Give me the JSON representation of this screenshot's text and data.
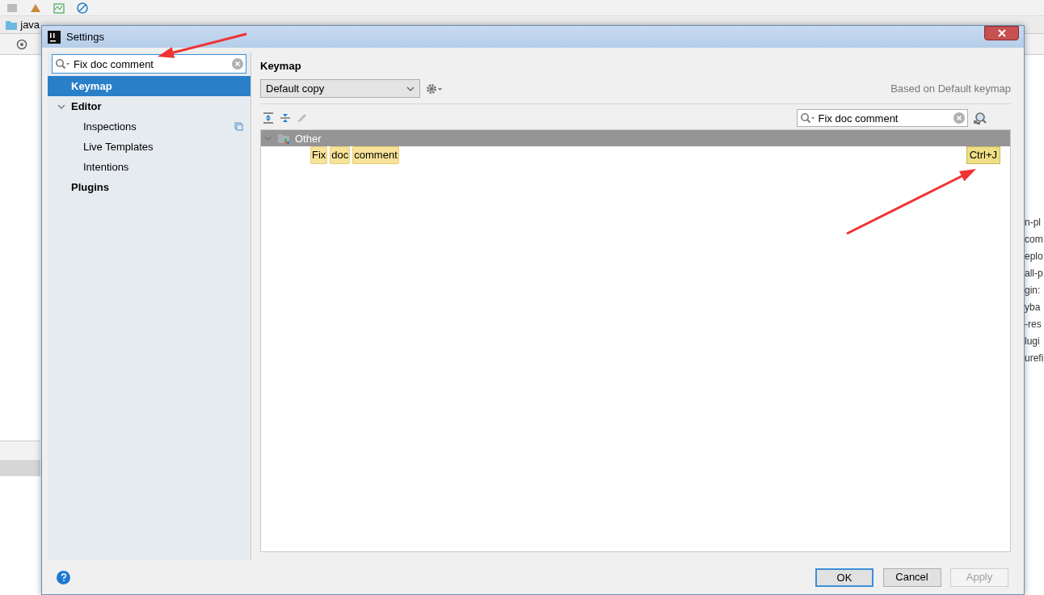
{
  "ide": {
    "breadcrumb": [
      "java"
    ],
    "side_text": [
      "n-pl",
      "com",
      "eplo",
      "all-p",
      "gin:",
      "yba",
      "-res",
      "lugi",
      "urefi"
    ]
  },
  "dialog": {
    "title": "Settings",
    "search": {
      "value": "Fix doc comment"
    },
    "nav": [
      {
        "label": "Keymap",
        "selected": true
      },
      {
        "label": "Editor",
        "selected": false,
        "expanded": true,
        "children": [
          {
            "label": "Inspections",
            "selected": false,
            "project_icon": true
          },
          {
            "label": "Live Templates",
            "selected": false,
            "project_icon": false
          },
          {
            "label": "Intentions",
            "selected": false,
            "project_icon": false
          }
        ]
      },
      {
        "label": "Plugins",
        "selected": false
      }
    ],
    "heading": "Keymap",
    "keymap_select": "Default copy",
    "based_on": "Based on Default keymap",
    "filter": {
      "value": "Fix doc comment"
    },
    "tree": [
      {
        "label": "Other",
        "expanded": true,
        "children": [
          {
            "words": [
              "Fix",
              "doc",
              "comment"
            ],
            "shortcut": "Ctrl+J"
          }
        ]
      }
    ],
    "buttons": [
      {
        "label": "OK",
        "kind": "default"
      },
      {
        "label": "Cancel",
        "kind": "normal"
      },
      {
        "label": "Apply",
        "kind": "disabled"
      }
    ]
  }
}
